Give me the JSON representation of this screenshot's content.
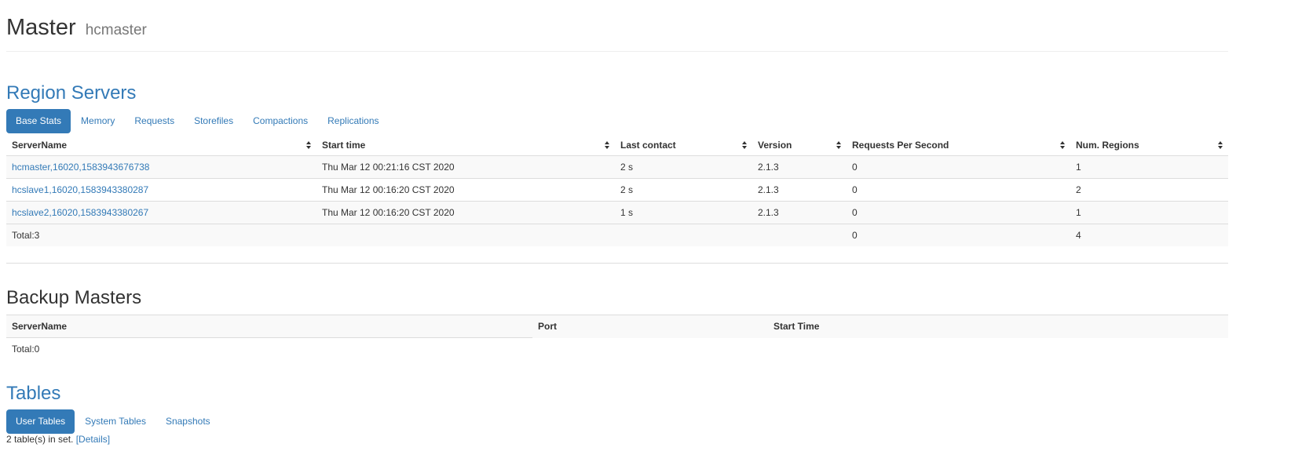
{
  "header": {
    "title": "Master",
    "subtitle": "hcmaster"
  },
  "region_servers": {
    "title": "Region Servers",
    "tabs": [
      "Base Stats",
      "Memory",
      "Requests",
      "Storefiles",
      "Compactions",
      "Replications"
    ],
    "active_tab": "Base Stats",
    "columns": [
      "ServerName",
      "Start time",
      "Last contact",
      "Version",
      "Requests Per Second",
      "Num. Regions"
    ],
    "rows": [
      {
        "server": "hcmaster,16020,1583943676738",
        "start": "Thu Mar 12 00:21:16 CST 2020",
        "contact": "2 s",
        "version": "2.1.3",
        "rps": "0",
        "regions": "1"
      },
      {
        "server": "hcslave1,16020,1583943380287",
        "start": "Thu Mar 12 00:16:20 CST 2020",
        "contact": "2 s",
        "version": "2.1.3",
        "rps": "0",
        "regions": "2"
      },
      {
        "server": "hcslave2,16020,1583943380267",
        "start": "Thu Mar 12 00:16:20 CST 2020",
        "contact": "1 s",
        "version": "2.1.3",
        "rps": "0",
        "regions": "1"
      }
    ],
    "total": {
      "label": "Total:3",
      "rps": "0",
      "regions": "4"
    }
  },
  "backup_masters": {
    "title": "Backup Masters",
    "columns": [
      "ServerName",
      "Port",
      "Start Time"
    ],
    "total": "Total:0"
  },
  "tables": {
    "title": "Tables",
    "tabs": [
      "User Tables",
      "System Tables",
      "Snapshots"
    ],
    "active_tab": "User Tables",
    "note": "2 table(s) in set.",
    "details_link": "[Details]"
  },
  "colors": {
    "link": "#337ab7",
    "active_tab_bg": "#337ab7",
    "stripe": "#f9f9f9",
    "border": "#dddddd"
  }
}
